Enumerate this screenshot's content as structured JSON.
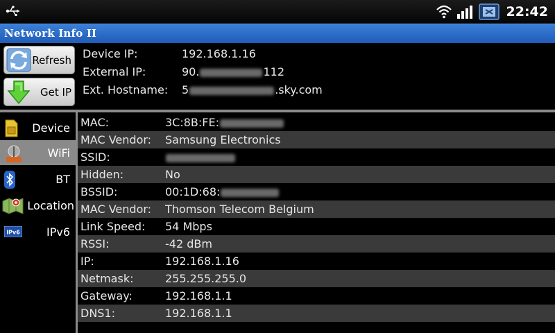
{
  "status_bar": {
    "time": "22:42",
    "icons": [
      "usb-icon",
      "wifi-icon",
      "signal-icon",
      "notification-icon"
    ]
  },
  "app": {
    "title": "Network Info II"
  },
  "buttons": {
    "refresh": "Refresh",
    "get_ip": "Get IP"
  },
  "header": {
    "device_ip_label": "Device IP:",
    "device_ip_value": "192.168.1.16",
    "external_ip_label": "External IP:",
    "external_ip_prefix": "90.",
    "external_ip_suffix": "112",
    "ext_hostname_label": "Ext. Hostname:",
    "ext_hostname_prefix": "5",
    "ext_hostname_suffix": ".sky.com"
  },
  "sidebar": {
    "items": [
      {
        "label": "Device",
        "icon": "sim-card-icon"
      },
      {
        "label": "WiFi",
        "icon": "wifi-router-icon",
        "active": true
      },
      {
        "label": "BT",
        "icon": "bluetooth-icon"
      },
      {
        "label": "Location",
        "icon": "map-pin-icon"
      },
      {
        "label": "IPv6",
        "icon": "ipv6-icon"
      }
    ]
  },
  "wifi_info": {
    "rows": [
      {
        "key": "MAC:",
        "value": "3C:8B:FE:"
      },
      {
        "key": "MAC Vendor:",
        "value": "Samsung Electronics"
      },
      {
        "key": "SSID:",
        "value": ""
      },
      {
        "key": "Hidden:",
        "value": "No"
      },
      {
        "key": "BSSID:",
        "value": "00:1D:68:"
      },
      {
        "key": "MAC Vendor:",
        "value": "Thomson Telecom Belgium"
      },
      {
        "key": "Link Speed:",
        "value": "54 Mbps"
      },
      {
        "key": "RSSI:",
        "value": "-42 dBm"
      },
      {
        "key": "IP:",
        "value": "192.168.1.16"
      },
      {
        "key": "Netmask:",
        "value": "255.255.255.0"
      },
      {
        "key": "Gateway:",
        "value": "192.168.1.1"
      },
      {
        "key": "DNS1:",
        "value": "192.168.1.1"
      }
    ]
  },
  "colors": {
    "title_bar": "#2a6bcb",
    "row_light": "#3a3a3a",
    "row_dark": "#000000",
    "active_tab": "#8a8a8a"
  }
}
